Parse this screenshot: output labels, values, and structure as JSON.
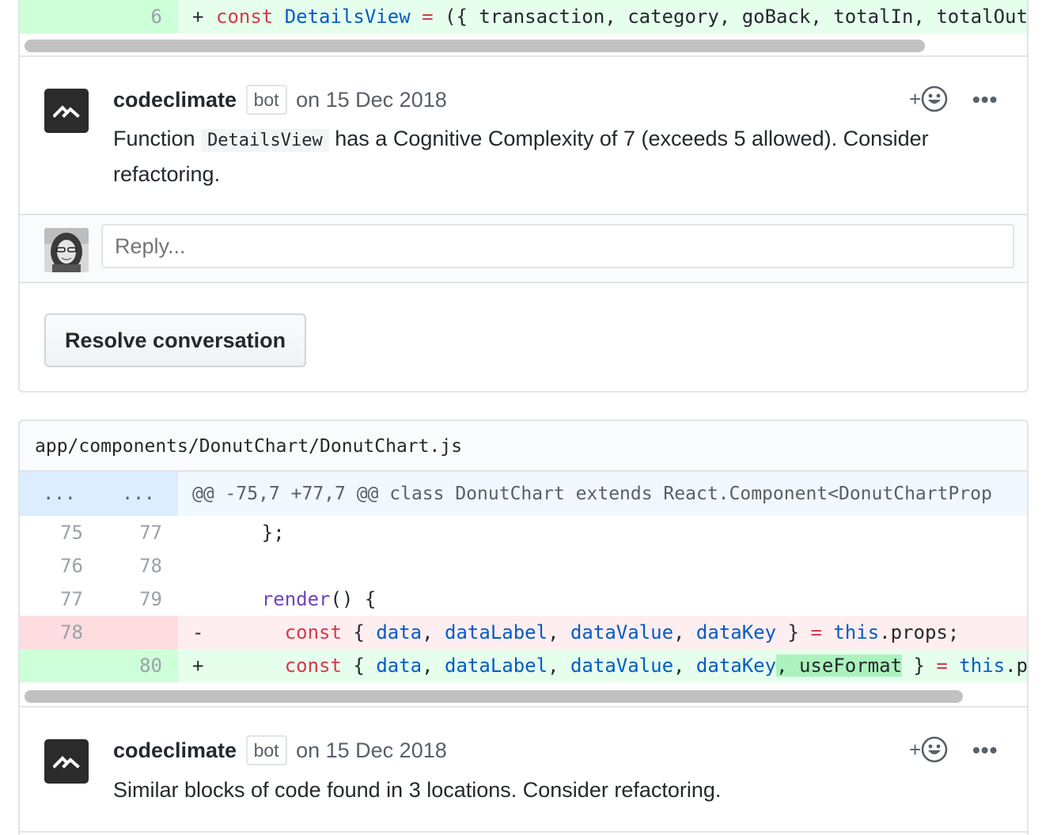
{
  "top_diff": {
    "line": {
      "new_num": "6",
      "sign": "+",
      "code": [
        {
          "t": "const",
          "c": "k"
        },
        {
          "t": " ",
          "c": "t"
        },
        {
          "t": "DetailsView",
          "c": "e"
        },
        {
          "t": " ",
          "c": "t"
        },
        {
          "t": "=",
          "c": "k"
        },
        {
          "t": " ({ transaction, category, goBack, totalIn, totalOut",
          "c": "t"
        }
      ]
    }
  },
  "comment1": {
    "author": "codeclimate",
    "badge": "bot",
    "date": "on 15 Dec 2018",
    "body_before": "Function ",
    "body_code": "DetailsView",
    "body_after": " has a Cognitive Complexity of 7 (exceeds 5 allowed). Consider",
    "body_line2": "refactoring.",
    "reaction_plus": "+",
    "more": "•••"
  },
  "reply": {
    "placeholder": "Reply..."
  },
  "resolve_button": "Resolve conversation",
  "file": {
    "path": "app/components/DonutChart/DonutChart.js",
    "hunk": {
      "old": "...",
      "new": "...",
      "text": "@@ -75,7 +77,7 @@ class DonutChart extends React.Component<DonutChartProp"
    },
    "lines": [
      {
        "type": "ctx",
        "old": "75",
        "new": "77",
        "sign": "",
        "code": [
          {
            "t": "    };",
            "c": "t"
          }
        ]
      },
      {
        "type": "ctx",
        "old": "76",
        "new": "78",
        "sign": "",
        "code": []
      },
      {
        "type": "ctx",
        "old": "77",
        "new": "79",
        "sign": "",
        "code": [
          {
            "t": "    ",
            "c": "t"
          },
          {
            "t": "render",
            "c": "f"
          },
          {
            "t": "() {",
            "c": "t"
          }
        ]
      },
      {
        "type": "del",
        "old": "78",
        "new": "",
        "sign": "-",
        "code": [
          {
            "t": "      ",
            "c": "t"
          },
          {
            "t": "const",
            "c": "k"
          },
          {
            "t": " { ",
            "c": "t"
          },
          {
            "t": "data",
            "c": "e"
          },
          {
            "t": ", ",
            "c": "t"
          },
          {
            "t": "dataLabel",
            "c": "e"
          },
          {
            "t": ", ",
            "c": "t"
          },
          {
            "t": "dataValue",
            "c": "e"
          },
          {
            "t": ", ",
            "c": "t"
          },
          {
            "t": "dataKey",
            "c": "e"
          },
          {
            "t": " } ",
            "c": "t"
          },
          {
            "t": "=",
            "c": "k"
          },
          {
            "t": " ",
            "c": "t"
          },
          {
            "t": "this",
            "c": "e"
          },
          {
            "t": ".props;",
            "c": "t"
          }
        ]
      },
      {
        "type": "add",
        "old": "",
        "new": "80",
        "sign": "+",
        "code": [
          {
            "t": "      ",
            "c": "t"
          },
          {
            "t": "const",
            "c": "k"
          },
          {
            "t": " { ",
            "c": "t"
          },
          {
            "t": "data",
            "c": "e"
          },
          {
            "t": ", ",
            "c": "t"
          },
          {
            "t": "dataLabel",
            "c": "e"
          },
          {
            "t": ", ",
            "c": "t"
          },
          {
            "t": "dataValue",
            "c": "e"
          },
          {
            "t": ", ",
            "c": "t"
          },
          {
            "t": "dataKey",
            "c": "e"
          },
          {
            "t": ", useFormat",
            "c": "hl t"
          },
          {
            "t": " } ",
            "c": "t"
          },
          {
            "t": "=",
            "c": "k"
          },
          {
            "t": " ",
            "c": "t"
          },
          {
            "t": "this",
            "c": "e"
          },
          {
            "t": ".pro",
            "c": "t"
          }
        ]
      }
    ]
  },
  "comment2": {
    "author": "codeclimate",
    "badge": "bot",
    "date": "on 15 Dec 2018",
    "body": "Similar blocks of code found in 3 locations. Consider refactoring.",
    "reaction_plus": "+",
    "more": "•••"
  },
  "icons": {
    "bot_avatar": "codeclimate-logo-icon",
    "reaction": "smiley-icon",
    "more": "kebab-horizontal-icon"
  }
}
